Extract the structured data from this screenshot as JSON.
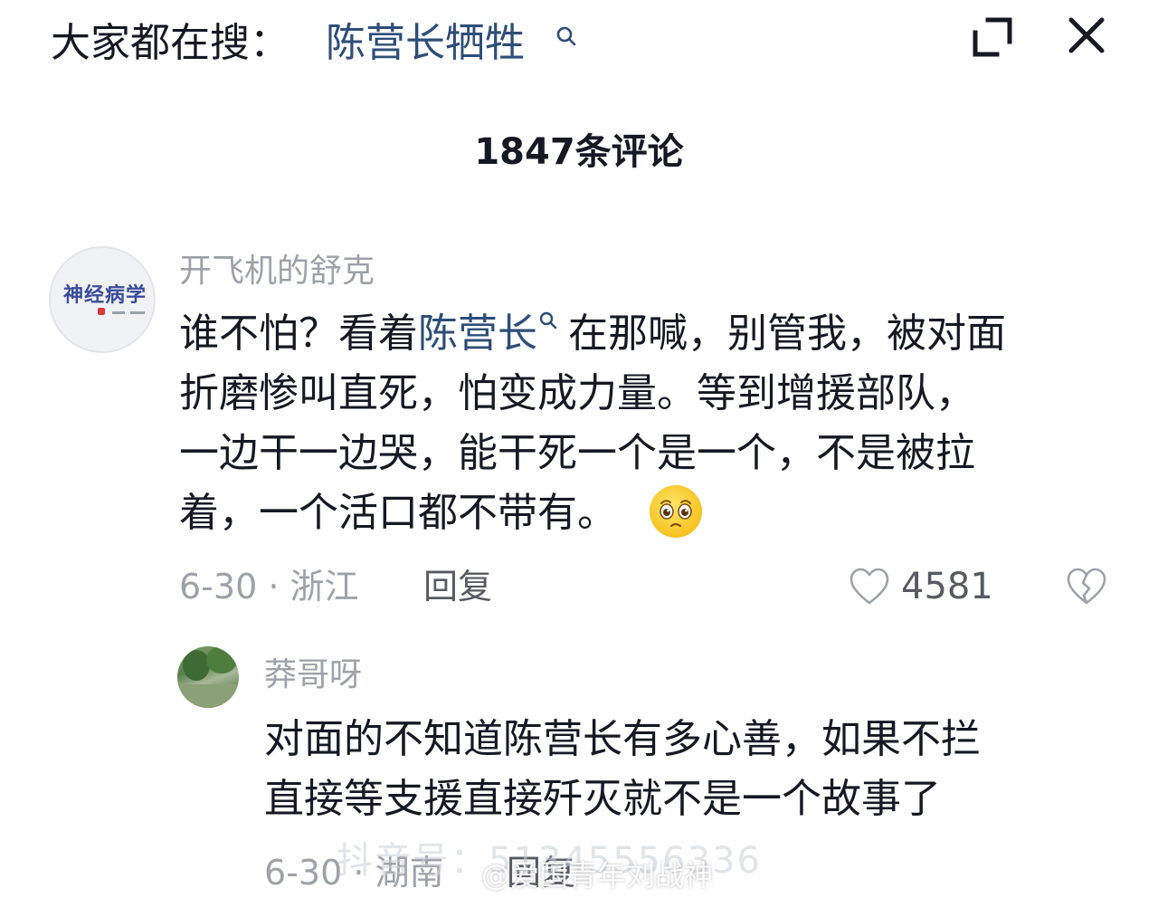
{
  "header": {
    "hot_label": "大家都在搜：",
    "hot_query": "陈营长牺牲",
    "expand_icon": "expand-icon",
    "close_icon": "close-icon"
  },
  "comments_title": "1847条评论",
  "comments": [
    {
      "username": "开飞机的舒克",
      "avatar_text": "神经病学",
      "text_lines": [
        {
          "before": "谁不怕？看着",
          "link": "陈营长",
          "after": "在那喊，别管我，被对面"
        },
        {
          "text": "折磨惨叫直死，怕变成力量。等到增援部队，"
        },
        {
          "text": "一边干一边哭，能干死一个是一个，不是被拉"
        },
        {
          "text": "着，一个活口都不带有。"
        }
      ],
      "emoji": "pleading-face-emoji",
      "meta": "6-30 · 浙江",
      "reply_label": "回复",
      "likes": "4581"
    },
    {
      "username": "莽哥呀",
      "text_lines": [
        {
          "text": "对面的不知道陈营长有多心善，如果不拦"
        },
        {
          "text": "直接等支援直接歼灭就不是一个故事了"
        }
      ],
      "meta": "6-30 · 湖南",
      "reply_label": "回复"
    }
  ],
  "watermarks": {
    "douyin": "抖音号：51345556336",
    "weibo": "@爱国青年刘战神"
  },
  "colors": {
    "link": "#2d4e78",
    "secondary": "#9ea1a8",
    "text": "#161823"
  }
}
